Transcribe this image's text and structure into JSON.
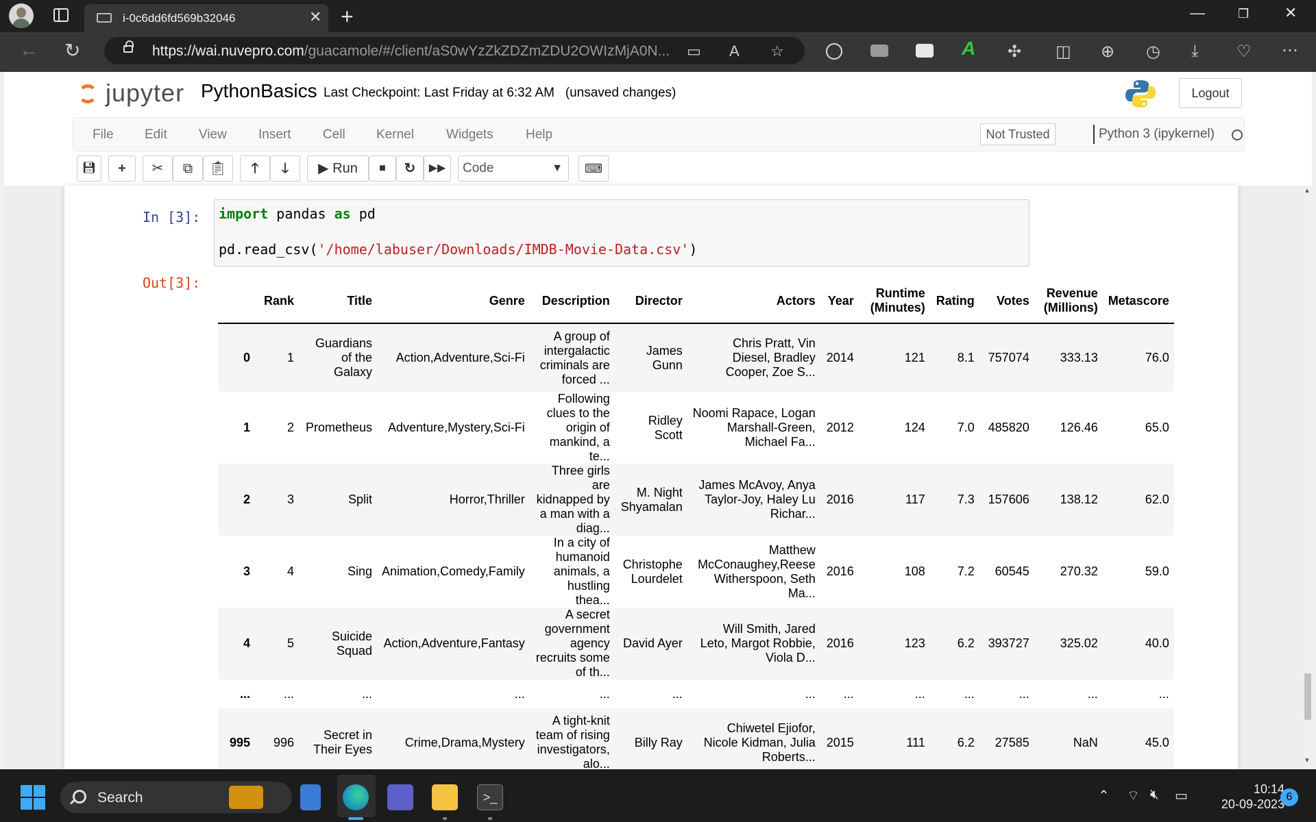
{
  "browser": {
    "tab_title": "i-0c6dd6fd569b32046",
    "url_host": "https://wai.nuvepro.com",
    "url_path": "/guacamole/#/client/aS0wYzZkZDZmZDU2OWIzMjA0N..."
  },
  "jupyter": {
    "logo_text": "jupyter",
    "notebook_name": "PythonBasics",
    "checkpoint": "Last Checkpoint: Last Friday at 6:32 AM",
    "unsaved": "(unsaved changes)",
    "logout_label": "Logout",
    "menu": [
      "File",
      "Edit",
      "View",
      "Insert",
      "Cell",
      "Kernel",
      "Widgets",
      "Help"
    ],
    "trust_label": "Not Trusted",
    "kernel_name": "Python 3 (ipykernel)",
    "run_label": "Run",
    "cell_type": "Code"
  },
  "cell": {
    "in_prompt": "In [3]:",
    "out_prompt": "Out[3]:",
    "code_line1_kw1": "import",
    "code_line1_mid": " pandas ",
    "code_line1_kw2": "as",
    "code_line1_end": " pd",
    "code_line2_pre": "pd.read_csv(",
    "code_line2_str": "'/home/labuser/Downloads/IMDB-Movie-Data.csv'",
    "code_line2_post": ")"
  },
  "dataframe": {
    "columns": [
      "",
      "Rank",
      "Title",
      "Genre",
      "Description",
      "Director",
      "Actors",
      "Year",
      "Runtime (Minutes)",
      "Rating",
      "Votes",
      "Revenue (Millions)",
      "Metascore"
    ],
    "rows": [
      [
        "0",
        "1",
        "Guardians of the Galaxy",
        "Action,Adventure,Sci-Fi",
        "A group of intergalactic criminals are forced ...",
        "James Gunn",
        "Chris Pratt, Vin Diesel, Bradley Cooper, Zoe S...",
        "2014",
        "121",
        "8.1",
        "757074",
        "333.13",
        "76.0"
      ],
      [
        "1",
        "2",
        "Prometheus",
        "Adventure,Mystery,Sci-Fi",
        "Following clues to the origin of mankind, a te...",
        "Ridley Scott",
        "Noomi Rapace, Logan Marshall-Green, Michael Fa...",
        "2012",
        "124",
        "7.0",
        "485820",
        "126.46",
        "65.0"
      ],
      [
        "2",
        "3",
        "Split",
        "Horror,Thriller",
        "Three girls are kidnapped by a man with a diag...",
        "M. Night Shyamalan",
        "James McAvoy, Anya Taylor-Joy, Haley Lu Richar...",
        "2016",
        "117",
        "7.3",
        "157606",
        "138.12",
        "62.0"
      ],
      [
        "3",
        "4",
        "Sing",
        "Animation,Comedy,Family",
        "In a city of humanoid animals, a hustling thea...",
        "Christophe Lourdelet",
        "Matthew McConaughey,Reese Witherspoon, Seth Ma...",
        "2016",
        "108",
        "7.2",
        "60545",
        "270.32",
        "59.0"
      ],
      [
        "4",
        "5",
        "Suicide Squad",
        "Action,Adventure,Fantasy",
        "A secret government agency recruits some of th...",
        "David Ayer",
        "Will Smith, Jared Leto, Margot Robbie, Viola D...",
        "2016",
        "123",
        "6.2",
        "393727",
        "325.02",
        "40.0"
      ],
      [
        "...",
        "...",
        "...",
        "...",
        "...",
        "...",
        "...",
        "...",
        "...",
        "...",
        "...",
        "...",
        "..."
      ],
      [
        "995",
        "996",
        "Secret in Their Eyes",
        "Crime,Drama,Mystery",
        "A tight-knit team of rising investigators, alo...",
        "Billy Ray",
        "Chiwetel Ejiofor, Nicole Kidman, Julia Roberts...",
        "2015",
        "111",
        "6.2",
        "27585",
        "NaN",
        "45.0"
      ]
    ]
  },
  "taskbar": {
    "search_label": "Search",
    "time": "10:14",
    "date": "20-09-2023",
    "notification_count": "6"
  }
}
